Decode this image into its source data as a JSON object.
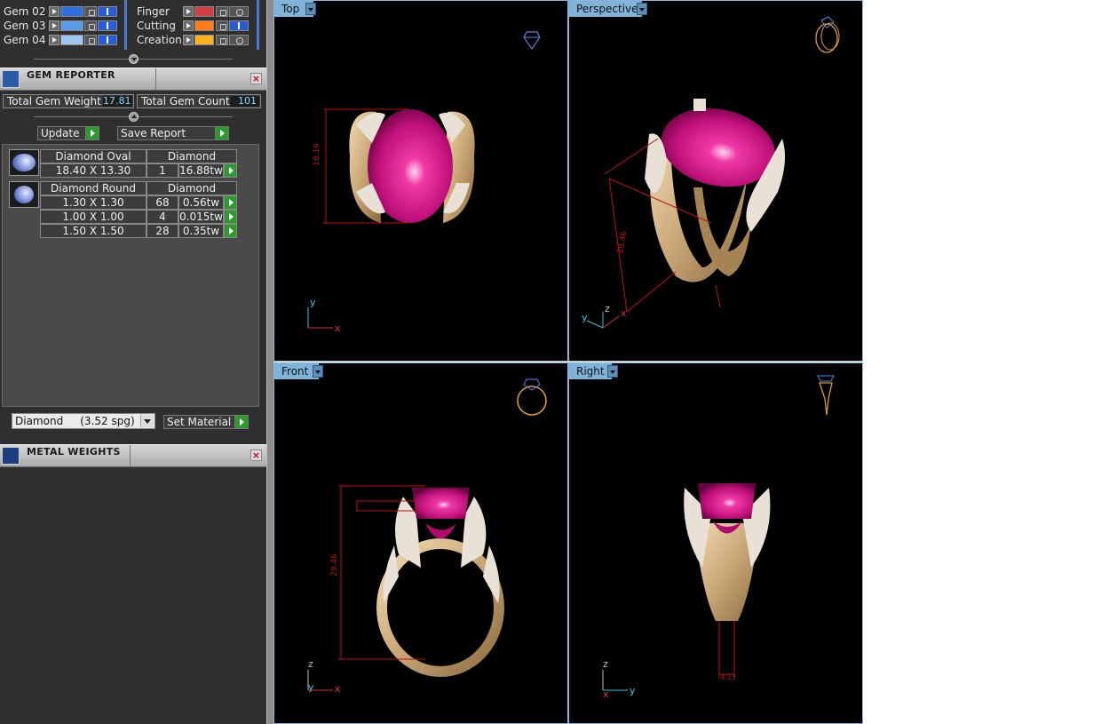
{
  "layers": {
    "left": [
      {
        "name": "Gem 02",
        "color": "#2f6fe0"
      },
      {
        "name": "Gem 03",
        "color": "#5b9be8"
      },
      {
        "name": "Gem 04",
        "color": "#9fc4f0"
      }
    ],
    "right": [
      {
        "name": "Finger",
        "color": "#d04040"
      },
      {
        "name": "Cutting",
        "color": "#ff7a1a"
      },
      {
        "name": "Creation",
        "color": "#ffb020"
      }
    ]
  },
  "gem_reporter": {
    "title": "GEM REPORTER",
    "total_weight_label": "Total Gem Weight",
    "total_weight_value": "17.81",
    "total_count_label": "Total Gem Count",
    "total_count_value": "101",
    "update_label": "Update",
    "save_label": "Save Report",
    "groups": [
      {
        "shape": "Diamond Oval",
        "material": "Diamond",
        "rows": [
          {
            "size": "18.40 X 13.30",
            "count": "1",
            "weight": "16.88tw"
          }
        ]
      },
      {
        "shape": "Diamond Round",
        "material": "Diamond",
        "rows": [
          {
            "size": "1.30 X 1.30",
            "count": "68",
            "weight": "0.56tw"
          },
          {
            "size": "1.00 X 1.00",
            "count": "4",
            "weight": "0.015tw"
          },
          {
            "size": "1.50 X 1.50",
            "count": "28",
            "weight": "0.35tw"
          }
        ]
      }
    ],
    "material_select": "Diamond     (3.52 spg)",
    "set_material_label": "Set Material"
  },
  "metal_weights": {
    "title": "METAL WEIGHTS"
  },
  "viewports": {
    "top": {
      "tab": "Top",
      "dim": "18.16",
      "axes": [
        "y",
        "x"
      ]
    },
    "perspective": {
      "tab": "Perspective",
      "dim": "28.46",
      "axes": [
        "y",
        "z",
        "x"
      ]
    },
    "front": {
      "tab": "Front",
      "dim": "29.46",
      "axes": [
        "z",
        "y",
        "x"
      ]
    },
    "right": {
      "tab": "Right",
      "dim": "4.13",
      "axes": [
        "z",
        "x",
        "y"
      ]
    }
  },
  "colors": {
    "gold": "#d8b98a",
    "ruby": "#e0197f",
    "viewport_tab": "#7fb3d9",
    "dimension": "#c01010"
  }
}
